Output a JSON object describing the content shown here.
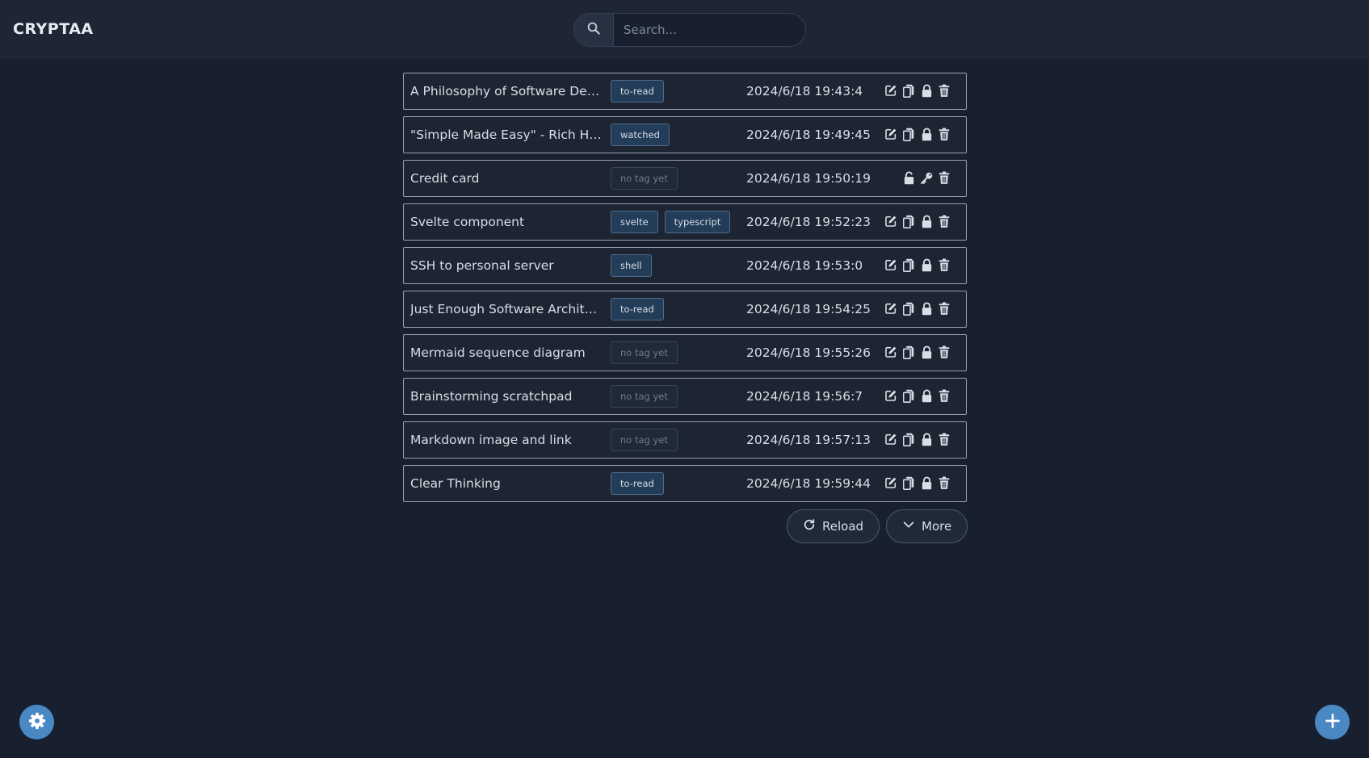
{
  "app": {
    "title": "CRYPTAA"
  },
  "search": {
    "placeholder": "Search..."
  },
  "items": [
    {
      "title": "A Philosophy of Software Design",
      "tags": [
        "to-read"
      ],
      "date": "2024/6/18 19:43:4",
      "locked": false
    },
    {
      "title": "\"Simple Made Easy\" - Rich Hickey",
      "tags": [
        "watched"
      ],
      "date": "2024/6/18 19:49:45",
      "locked": false
    },
    {
      "title": "Credit card",
      "tags": [],
      "date": "2024/6/18 19:50:19",
      "locked": true
    },
    {
      "title": "Svelte component",
      "tags": [
        "svelte",
        "typescript"
      ],
      "date": "2024/6/18 19:52:23",
      "locked": false
    },
    {
      "title": "SSH to personal server",
      "tags": [
        "shell"
      ],
      "date": "2024/6/18 19:53:0",
      "locked": false
    },
    {
      "title": "Just Enough Software Architect…",
      "tags": [
        "to-read"
      ],
      "date": "2024/6/18 19:54:25",
      "locked": false
    },
    {
      "title": "Mermaid sequence diagram",
      "tags": [],
      "date": "2024/6/18 19:55:26",
      "locked": false
    },
    {
      "title": "Brainstorming scratchpad",
      "tags": [],
      "date": "2024/6/18 19:56:7",
      "locked": false
    },
    {
      "title": "Markdown image and link",
      "tags": [],
      "date": "2024/6/18 19:57:13",
      "locked": false
    },
    {
      "title": "Clear Thinking",
      "tags": [
        "to-read"
      ],
      "date": "2024/6/18 19:59:44",
      "locked": false
    }
  ],
  "empty_tag_label": "no tag yet",
  "buttons": {
    "reload": "Reload",
    "more": "More"
  },
  "icons": {
    "search": "search-icon",
    "edit": "edit-icon",
    "copy": "copy-icon",
    "lock": "lock-icon",
    "unlock": "unlock-icon",
    "key": "key-icon",
    "delete": "trash-icon",
    "reload": "reload-icon",
    "more": "chevron-down-icon",
    "settings": "gear-icon",
    "add": "plus-icon"
  },
  "colors": {
    "background": "#182030",
    "header": "#1e2634",
    "tag": "#233c57",
    "accent": "#4a88c4"
  }
}
